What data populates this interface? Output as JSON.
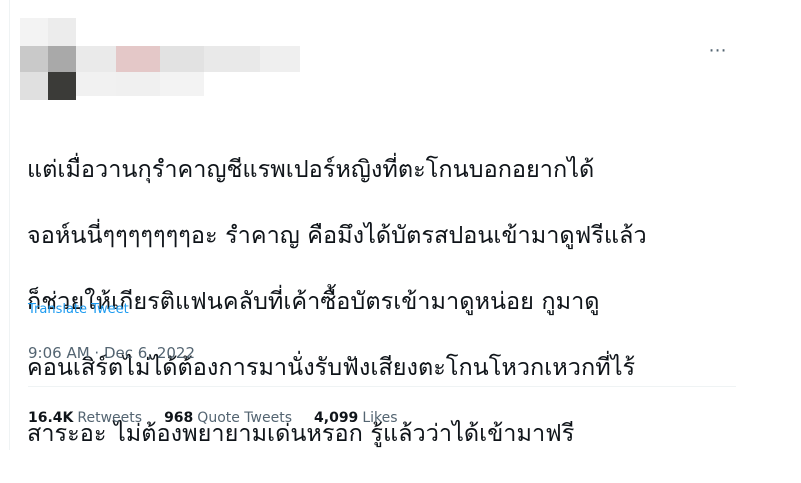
{
  "tweet": {
    "more_icon": "⋯",
    "text_lines": [
      "แต่เมื่อวานกุรำคาญชีแรพเปอร์หญิงที่ตะโกนบอกอยากได้",
      "จอห์นนี่ๆๆๆๆๆๆๆอะ รำคาญ คือมึงได้บัตรสปอนเข้ามาดูฟรีแล้ว",
      "ก็ช่วยให้เกียรติแฟนคลับที่เค้าซื้อบัตรเข้ามาดูหน่อย กูมาดู",
      "คอนเสิร์ตไม่ได้ต้องการมานั่งรับฟังเสียงตะโกนโหวกเหวกที่ไร้",
      "สาระอะ ไม่ต้องพยายามเด่นหรอก รู้แล้วว่าได้เข้ามาฟรี"
    ],
    "translate_label": "Translate Tweet",
    "timestamp": "9:06 AM · Dec 6, 2022",
    "stats": {
      "retweets_count": "16.4K",
      "retweets_label": "Retweets",
      "quotes_count": "968",
      "quotes_label": "Quote Tweets",
      "likes_count": "4,099",
      "likes_label": "Likes"
    }
  }
}
